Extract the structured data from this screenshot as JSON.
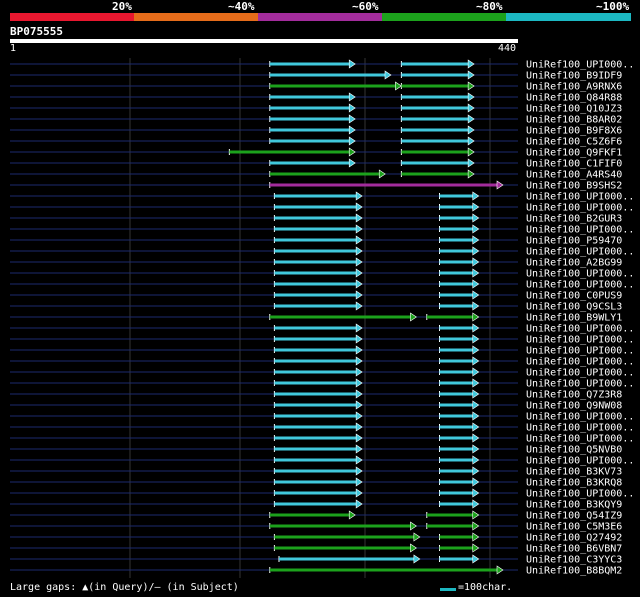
{
  "scale": {
    "ticks": [
      "20%",
      "~40%",
      "~60%",
      "~80%",
      "~100%"
    ],
    "colors": [
      "#e8172f",
      "#e56c1a",
      "#a32c9c",
      "#1ca21c",
      "#1cb8c2"
    ]
  },
  "query": {
    "id": "BP075555",
    "start": "1",
    "end": "440"
  },
  "legend": {
    "gaps": "Large gaps: ▲(in Query)/– (in Subject)",
    "scale_label": "=100char."
  },
  "chart_data": {
    "type": "alignment-map",
    "query_length": 440,
    "hits": [
      {
        "name": "UniRef100_UPI000..",
        "color": "cyan",
        "segs": [
          [
            225,
            299
          ],
          [
            339,
            402
          ]
        ]
      },
      {
        "name": "UniRef100_B9IDF9",
        "color": "cyan",
        "segs": [
          [
            225,
            330
          ],
          [
            339,
            402
          ]
        ]
      },
      {
        "name": "UniRef100_A9RNX6",
        "color": "green",
        "segs": [
          [
            225,
            339
          ],
          [
            339,
            402
          ]
        ]
      },
      {
        "name": "UniRef100_Q84R88",
        "color": "cyan",
        "segs": [
          [
            225,
            299
          ],
          [
            339,
            402
          ]
        ]
      },
      {
        "name": "UniRef100_Q10JZ3",
        "color": "cyan",
        "segs": [
          [
            225,
            299
          ],
          [
            339,
            402
          ]
        ]
      },
      {
        "name": "UniRef100_B8AR02",
        "color": "cyan",
        "segs": [
          [
            225,
            299
          ],
          [
            339,
            402
          ]
        ]
      },
      {
        "name": "UniRef100_B9F8X6",
        "color": "cyan",
        "segs": [
          [
            225,
            299
          ],
          [
            339,
            402
          ]
        ]
      },
      {
        "name": "UniRef100_C5Z6F6",
        "color": "cyan",
        "segs": [
          [
            225,
            299
          ],
          [
            339,
            402
          ]
        ]
      },
      {
        "name": "UniRef100_Q9FKF1",
        "color": "green",
        "segs": [
          [
            190,
            299
          ],
          [
            339,
            402
          ]
        ]
      },
      {
        "name": "UniRef100_C1FIF0",
        "color": "cyan",
        "segs": [
          [
            225,
            299
          ],
          [
            339,
            402
          ]
        ]
      },
      {
        "name": "UniRef100_A4RS40",
        "color": "green",
        "segs": [
          [
            225,
            325
          ],
          [
            339,
            402
          ]
        ]
      },
      {
        "name": "UniRef100_B9SHS2",
        "color": "magenta",
        "segs": [
          [
            225,
            427
          ]
        ]
      },
      {
        "name": "UniRef100_UPI000..",
        "color": "cyan",
        "segs": [
          [
            229,
            305
          ],
          [
            372,
            406
          ]
        ]
      },
      {
        "name": "UniRef100_UPI000..",
        "color": "cyan",
        "segs": [
          [
            229,
            305
          ],
          [
            372,
            406
          ]
        ]
      },
      {
        "name": "UniRef100_B2GUR3",
        "color": "cyan",
        "segs": [
          [
            229,
            305
          ],
          [
            372,
            406
          ]
        ]
      },
      {
        "name": "UniRef100_UPI000..",
        "color": "cyan",
        "segs": [
          [
            229,
            305
          ],
          [
            372,
            406
          ]
        ]
      },
      {
        "name": "UniRef100_P59470",
        "color": "cyan",
        "segs": [
          [
            229,
            305
          ],
          [
            372,
            406
          ]
        ]
      },
      {
        "name": "UniRef100_UPI000..",
        "color": "cyan",
        "segs": [
          [
            229,
            305
          ],
          [
            372,
            406
          ]
        ]
      },
      {
        "name": "UniRef100_A2BG99",
        "color": "cyan",
        "segs": [
          [
            229,
            305
          ],
          [
            372,
            406
          ]
        ]
      },
      {
        "name": "UniRef100_UPI000..",
        "color": "cyan",
        "segs": [
          [
            229,
            305
          ],
          [
            372,
            406
          ]
        ]
      },
      {
        "name": "UniRef100_UPI000..",
        "color": "cyan",
        "segs": [
          [
            229,
            305
          ],
          [
            372,
            406
          ]
        ]
      },
      {
        "name": "UniRef100_C0PUS9",
        "color": "cyan",
        "segs": [
          [
            229,
            305
          ],
          [
            372,
            406
          ]
        ]
      },
      {
        "name": "UniRef100_Q9CSL3",
        "color": "cyan",
        "segs": [
          [
            229,
            305
          ],
          [
            372,
            406
          ]
        ]
      },
      {
        "name": "UniRef100_B9WLY1",
        "color": "green",
        "segs": [
          [
            225,
            352
          ],
          [
            361,
            406
          ]
        ]
      },
      {
        "name": "UniRef100_UPI000..",
        "color": "cyan",
        "segs": [
          [
            229,
            305
          ],
          [
            372,
            406
          ]
        ]
      },
      {
        "name": "UniRef100_UPI000..",
        "color": "cyan",
        "segs": [
          [
            229,
            305
          ],
          [
            372,
            406
          ]
        ]
      },
      {
        "name": "UniRef100_UPI000..",
        "color": "cyan",
        "segs": [
          [
            229,
            305
          ],
          [
            372,
            406
          ]
        ]
      },
      {
        "name": "UniRef100_UPI000..",
        "color": "cyan",
        "segs": [
          [
            229,
            305
          ],
          [
            372,
            406
          ]
        ]
      },
      {
        "name": "UniRef100_UPI000..",
        "color": "cyan",
        "segs": [
          [
            229,
            305
          ],
          [
            372,
            406
          ]
        ]
      },
      {
        "name": "UniRef100_UPI000..",
        "color": "cyan",
        "segs": [
          [
            229,
            305
          ],
          [
            372,
            406
          ]
        ]
      },
      {
        "name": "UniRef100_Q7Z3R8",
        "color": "cyan",
        "segs": [
          [
            229,
            305
          ],
          [
            372,
            406
          ]
        ]
      },
      {
        "name": "UniRef100_Q9NW08",
        "color": "cyan",
        "segs": [
          [
            229,
            305
          ],
          [
            372,
            406
          ]
        ]
      },
      {
        "name": "UniRef100_UPI000..",
        "color": "cyan",
        "segs": [
          [
            229,
            305
          ],
          [
            372,
            406
          ]
        ]
      },
      {
        "name": "UniRef100_UPI000..",
        "color": "cyan",
        "segs": [
          [
            229,
            305
          ],
          [
            372,
            406
          ]
        ]
      },
      {
        "name": "UniRef100_UPI000..",
        "color": "cyan",
        "segs": [
          [
            229,
            305
          ],
          [
            372,
            406
          ]
        ]
      },
      {
        "name": "UniRef100_Q5NVB0",
        "color": "cyan",
        "segs": [
          [
            229,
            305
          ],
          [
            372,
            406
          ]
        ]
      },
      {
        "name": "UniRef100_UPI000..",
        "color": "cyan",
        "segs": [
          [
            229,
            305
          ],
          [
            372,
            406
          ]
        ]
      },
      {
        "name": "UniRef100_B3KV73",
        "color": "cyan",
        "segs": [
          [
            229,
            305
          ],
          [
            372,
            406
          ]
        ]
      },
      {
        "name": "UniRef100_B3KRQ8",
        "color": "cyan",
        "segs": [
          [
            229,
            305
          ],
          [
            372,
            406
          ]
        ]
      },
      {
        "name": "UniRef100_UPI000..",
        "color": "cyan",
        "segs": [
          [
            229,
            305
          ],
          [
            372,
            406
          ]
        ]
      },
      {
        "name": "UniRef100_B3KQY9",
        "color": "cyan",
        "segs": [
          [
            229,
            305
          ],
          [
            372,
            406
          ]
        ]
      },
      {
        "name": "UniRef100_Q54IZ9",
        "color": "green",
        "segs": [
          [
            225,
            299
          ],
          [
            361,
            406
          ]
        ]
      },
      {
        "name": "UniRef100_C5M3E6",
        "color": "green",
        "segs": [
          [
            225,
            352
          ],
          [
            361,
            406
          ]
        ]
      },
      {
        "name": "UniRef100_Q27492",
        "color": "green",
        "segs": [
          [
            229,
            355
          ],
          [
            372,
            406
          ]
        ]
      },
      {
        "name": "UniRef100_B6VBN7",
        "color": "green",
        "segs": [
          [
            229,
            352
          ],
          [
            372,
            406
          ]
        ]
      },
      {
        "name": "UniRef100_C3YYC3",
        "color": "cyan",
        "segs": [
          [
            233,
            355
          ],
          [
            372,
            406
          ]
        ]
      },
      {
        "name": "UniRef100_B8BQM2",
        "color": "green",
        "segs": [
          [
            225,
            427
          ]
        ]
      }
    ]
  }
}
